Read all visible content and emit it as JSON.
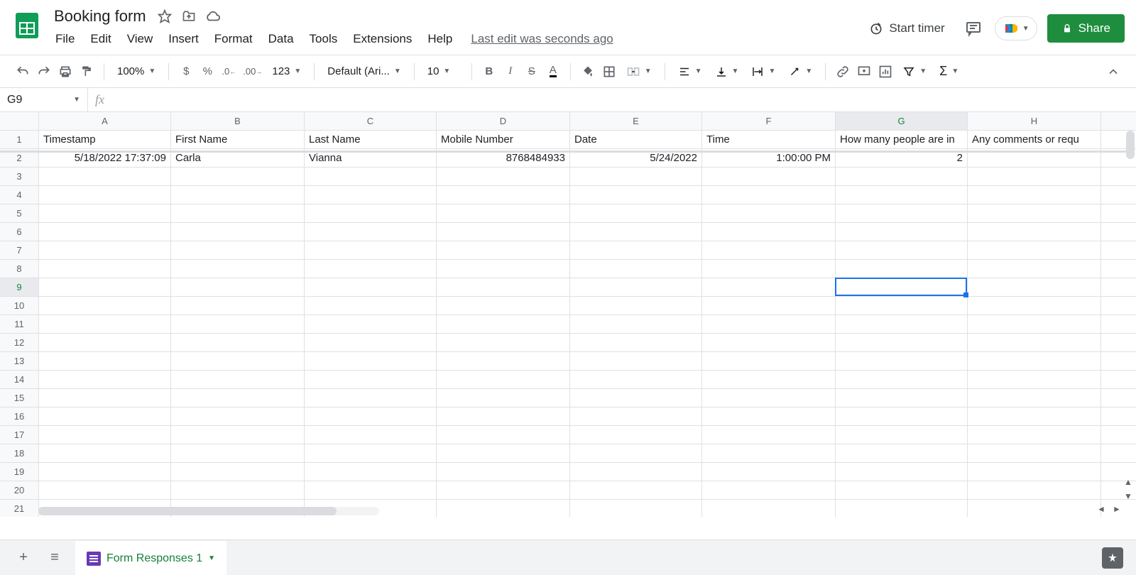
{
  "doc": {
    "title": "Booking form"
  },
  "menu": {
    "file": "File",
    "edit": "Edit",
    "view": "View",
    "insert": "Insert",
    "format": "Format",
    "data": "Data",
    "tools": "Tools",
    "extensions": "Extensions",
    "help": "Help",
    "last_edit": "Last edit was seconds ago"
  },
  "header": {
    "timer": "Start timer",
    "share": "Share"
  },
  "toolbar": {
    "zoom": "100%",
    "font": "Default (Ari...",
    "size": "10",
    "currency": "$",
    "percent": "%",
    "dec_less": ".0",
    "dec_more": ".00",
    "numfmt": "123",
    "bold": "B",
    "italic": "I",
    "strike": "S",
    "txtcolor": "A"
  },
  "namebox": "G9",
  "columns": [
    "A",
    "B",
    "C",
    "D",
    "E",
    "F",
    "G",
    "H"
  ],
  "row_count": 21,
  "headers": [
    "Timestamp",
    "First Name",
    "Last Name",
    "Mobile Number",
    "Date",
    "Time",
    "How many people are in",
    "Any comments or requ"
  ],
  "data_row": {
    "timestamp": "5/18/2022 17:37:09",
    "first": "Carla",
    "last": "Vianna",
    "mobile": "8768484933",
    "date": "5/24/2022",
    "time": "1:00:00 PM",
    "people": "2",
    "comments": ""
  },
  "sheet": {
    "name": "Form Responses 1"
  },
  "selection": {
    "col_index": 6,
    "row_index": 9
  }
}
